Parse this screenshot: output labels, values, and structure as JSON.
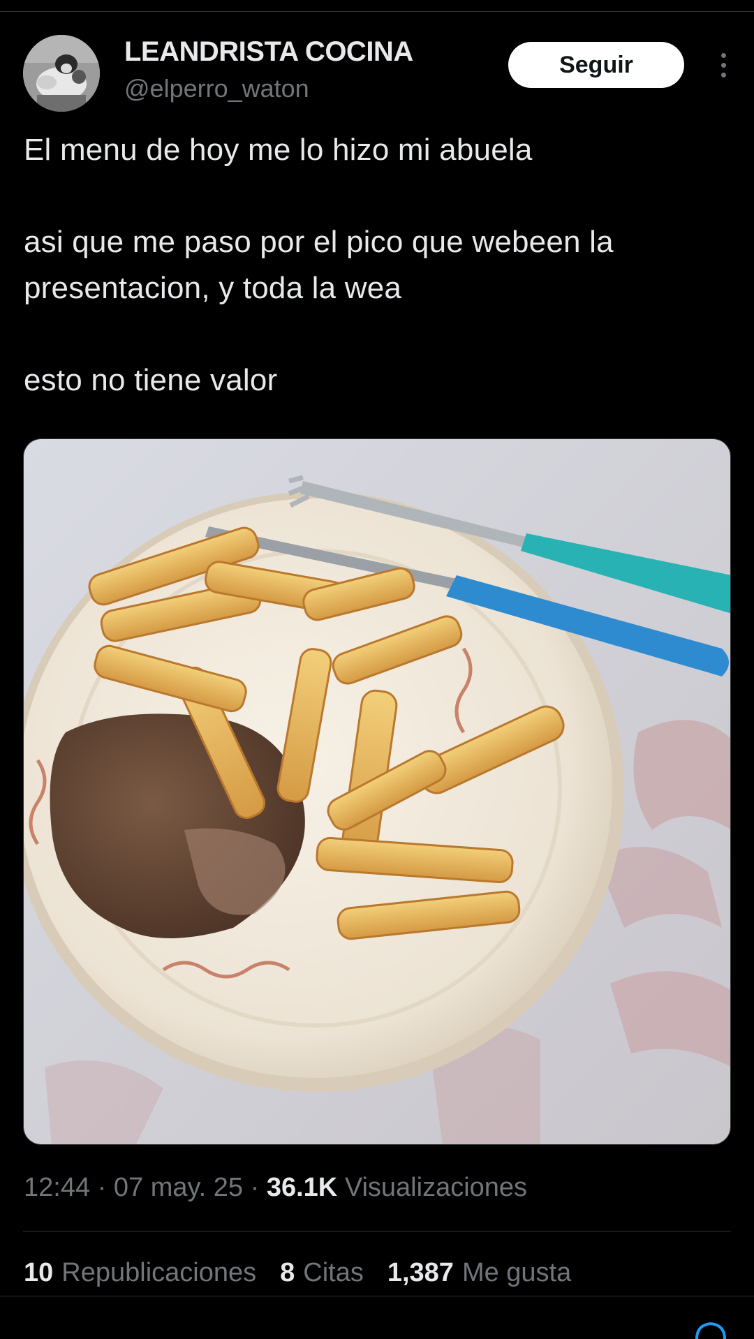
{
  "author": {
    "name": "LEANDRISTA COCINA",
    "handle": "@elperro_waton",
    "follow_label": "Seguir"
  },
  "tweet": {
    "lines": [
      "El menu de hoy me lo hizo mi abuela",
      "asi que me paso por el pico que webeen la presentacion, y toda la wea",
      "esto no tiene valor"
    ]
  },
  "meta": {
    "time": "12:44",
    "sep1": "·",
    "date": "07 may. 25",
    "sep2": "·",
    "views_count": "36.1K",
    "views_label": "Visualizaciones"
  },
  "stats": {
    "reposts_count": "10",
    "reposts_label": "Republicaciones",
    "quotes_count": "8",
    "quotes_label": "Citas",
    "likes_count": "1,387",
    "likes_label": "Me gusta"
  },
  "colors": {
    "background": "#000000",
    "text_primary": "#e7e9ea",
    "text_secondary": "#71767b",
    "follow_bg": "#ffffff",
    "accent": "#1d9bf0"
  },
  "icons": [
    "more-vertical-icon",
    "share-icon"
  ]
}
